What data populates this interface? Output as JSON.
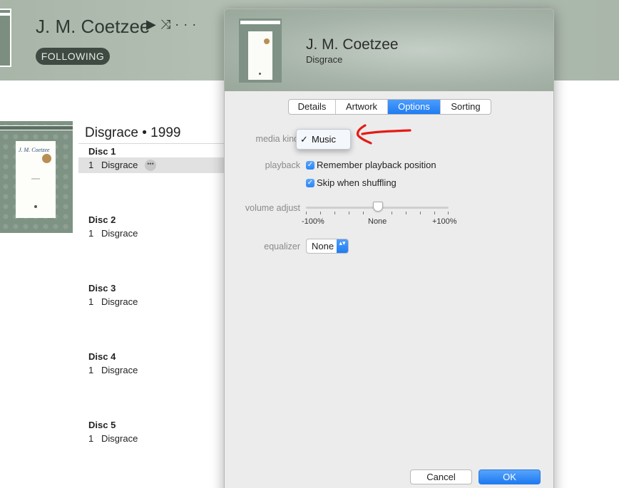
{
  "artist_page": {
    "artist_name": "J. M. Coetzee",
    "actions": {
      "play_glyph": "▶",
      "shuffle_glyph": "⤨",
      "more_glyph": "···"
    },
    "following_label": "FOLLOWING",
    "album": {
      "cover_author": "J. M. Coetzee",
      "title": "Disgrace • 1999",
      "discs": [
        {
          "label": "Disc 1",
          "track_num": "1",
          "track_name": "Disgrace",
          "selected": true
        },
        {
          "label": "Disc 2",
          "track_num": "1",
          "track_name": "Disgrace"
        },
        {
          "label": "Disc 3",
          "track_num": "1",
          "track_name": "Disgrace"
        },
        {
          "label": "Disc 4",
          "track_num": "1",
          "track_name": "Disgrace"
        },
        {
          "label": "Disc 5",
          "track_num": "1",
          "track_name": "Disgrace"
        }
      ],
      "more_glyph": "•••"
    }
  },
  "dialog": {
    "artist": "J. M. Coetzee",
    "album": "Disgrace",
    "tabs": [
      {
        "label": "Details",
        "active": false
      },
      {
        "label": "Artwork",
        "active": false
      },
      {
        "label": "Options",
        "active": true
      },
      {
        "label": "Sorting",
        "active": false
      }
    ],
    "media_kind": {
      "label": "media kind",
      "menu_check": "✓",
      "menu_selected": "Music"
    },
    "playback": {
      "label": "playback",
      "check_glyph": "✓",
      "remember_position": {
        "label": "Remember playback position",
        "checked": true
      },
      "skip_when_shuffling": {
        "label": "Skip when shuffling",
        "checked": true
      }
    },
    "volume_adjust": {
      "label": "volume adjust",
      "min_label": "-100%",
      "mid_label": "None",
      "max_label": "+100%",
      "value_percent": 0
    },
    "equalizer": {
      "label": "equalizer",
      "value": "None",
      "arrows_glyph": "▴▾"
    },
    "buttons": {
      "cancel": "Cancel",
      "ok": "OK"
    }
  },
  "colors": {
    "accent_blue": "#1f7cf3",
    "header_sage": "#a8b5a8",
    "following_bg": "#3f4a43",
    "annotation_red": "#e41b17"
  }
}
